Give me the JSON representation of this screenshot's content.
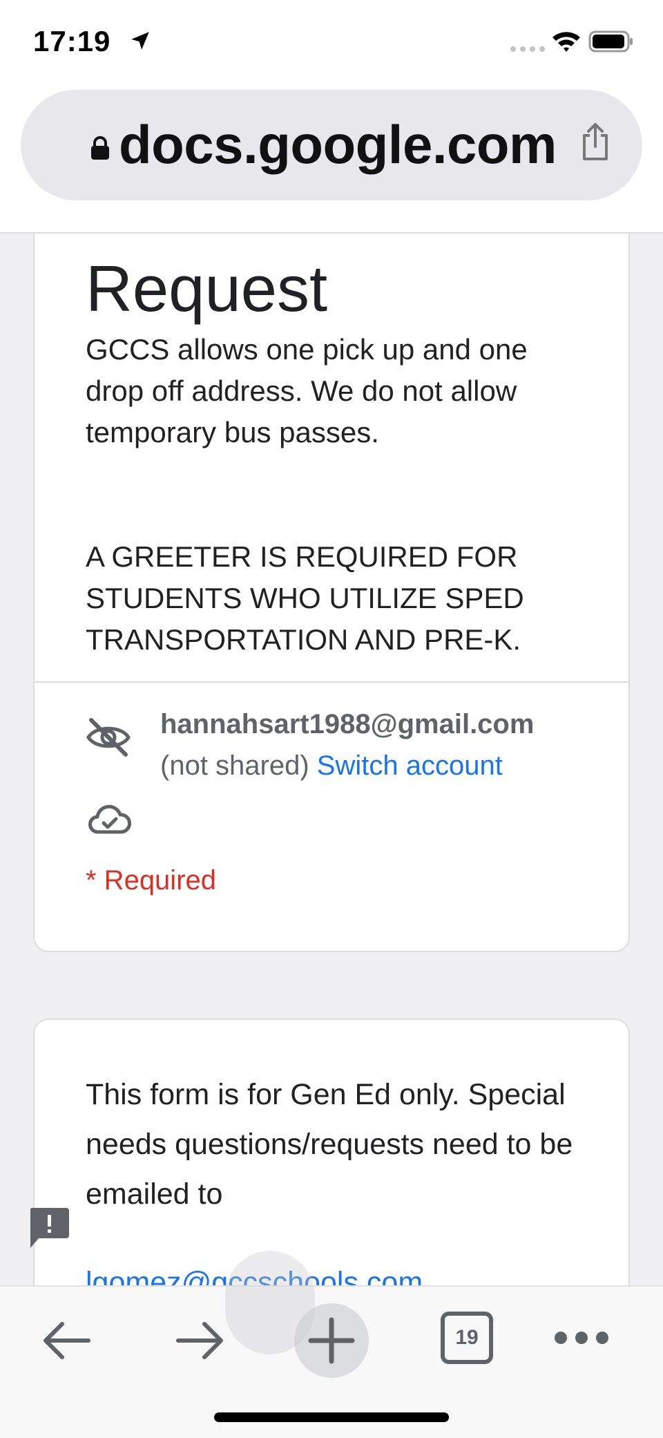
{
  "status_bar": {
    "time": "17:19"
  },
  "browser": {
    "url": "docs.google.com",
    "tab_count": "19"
  },
  "form": {
    "title": "Request",
    "description_1": "GCCS allows one pick up and one drop off address.  We do not allow temporary bus passes.",
    "description_2": "A GREETER IS REQUIRED FOR STUDENTS WHO UTILIZE SPED TRANSPORTATION AND PRE-K.",
    "account": {
      "email": "hannahsart1988@gmail.com",
      "not_shared": "(not shared)",
      "switch_label": "Switch account"
    },
    "required_label": "* Required"
  },
  "section2": {
    "text": "This form is for Gen Ed only. Special needs questions/requests need to be emailed to",
    "link_partial": "lgomez@gccschools.com"
  },
  "icons": {
    "location": "location-arrow-icon",
    "signal": "cellular-signal-icon",
    "wifi": "wifi-icon",
    "battery": "battery-icon",
    "lock": "lock-icon",
    "share": "share-icon",
    "eye_off": "eye-off-icon",
    "cloud_check": "cloud-check-icon",
    "feedback": "feedback-icon",
    "back": "back-arrow-icon",
    "forward": "forward-arrow-icon",
    "new_tab": "plus-icon",
    "more": "more-dots-icon"
  },
  "colors": {
    "link": "#1a73e8",
    "required": "#d93025",
    "page_bg": "#f0f0f3"
  }
}
